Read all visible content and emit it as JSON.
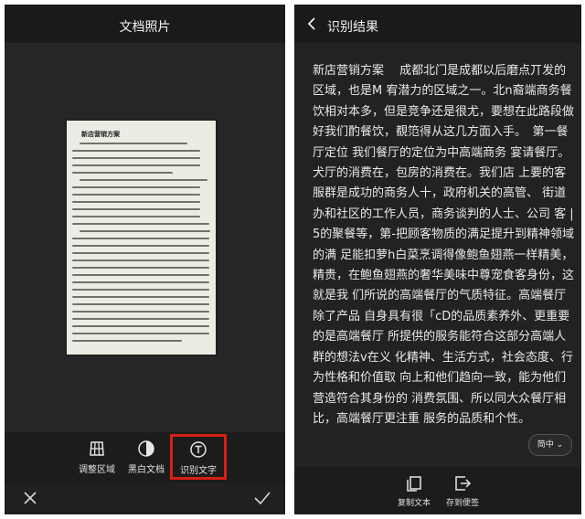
{
  "left": {
    "title": "文档照片",
    "photo_doc_title": "新店营销方案",
    "toolbar": [
      {
        "label": "调整区域",
        "icon": "adjust-area-icon"
      },
      {
        "label": "黑白文档",
        "icon": "black-white-icon"
      },
      {
        "label": "识别文字",
        "icon": "text-recognition-icon",
        "active": true
      }
    ],
    "cancel_icon": "close-icon",
    "confirm_icon": "check-icon"
  },
  "right": {
    "title": "识别结果",
    "back_icon": "back-arrow-icon",
    "text": "新店营销方案　 成都北门是成都以后磨点丌发的区域，也是M 宥潜力的区域之一。北n裔端商务餐饮相对本多，但是竞争还是很尤，要想在此路段做好我们酌餐饮，覩笵得从这几方面入手。　第一餐厅定位 我们餐厅的定位为中高端商务 宴请餐厅。犬厅的消费在，包房的消费在。我们店 上要的客服群是成功的商务人十，政府机关的高管、 街道办和社区的工作人员，商务谈判的人士、公司 客 | 5的聚餐等，第-把顾客物质的满足提升到精神领域的满 足能扣萝h白菜烹调得像鲍鱼翅燕一样精美，精贵，在鲍鱼翅燕的奢华美味中尊宠食客身份，这就是我 们所说的高端餐厅的气质特征。高端餐厅除了产品 自身具有很「cD的品质素养外、更重要的是高端餐厅 所提供的服务能符合这部分高端人群的想法v在义 化精神、生活方式，社会态度、行为性格和价值取 向上和他们趋向一致，能为他们营造符合其身份的 消费氛围、所以同大众餐厅相比，高端餐厅更注重 服务的品质和个性。",
    "lang_button": "简中",
    "bottom": [
      {
        "label": "复制文本",
        "icon": "copy-icon"
      },
      {
        "label": "存到便签",
        "icon": "export-note-icon"
      }
    ]
  },
  "colors": {
    "background": "#222222",
    "header": "#1a1a1a",
    "highlight": "#d81f16",
    "text": "#e9e9e9"
  }
}
